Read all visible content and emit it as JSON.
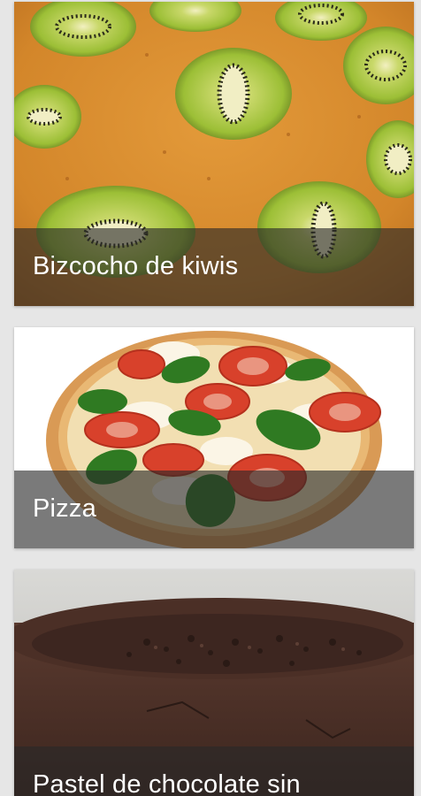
{
  "recipes": [
    {
      "title": "Bizcocho de kiwis",
      "image": "kiwi-sponge-cake-photo",
      "colors": {
        "crust": "#d68a2c",
        "kiwi": "#9ac13a",
        "seeds": "#2a2a1a"
      }
    },
    {
      "title": "Pizza",
      "image": "pizza-photo",
      "colors": {
        "dough": "#e7b673",
        "tomato": "#d8412b",
        "basil": "#2f7a22",
        "cheese": "#f3ecd8"
      }
    },
    {
      "title": "Pastel de chocolate sin",
      "image": "chocolate-cake-photo",
      "colors": {
        "cake": "#4a2f26",
        "crumbs": "#2c1c17"
      }
    }
  ]
}
